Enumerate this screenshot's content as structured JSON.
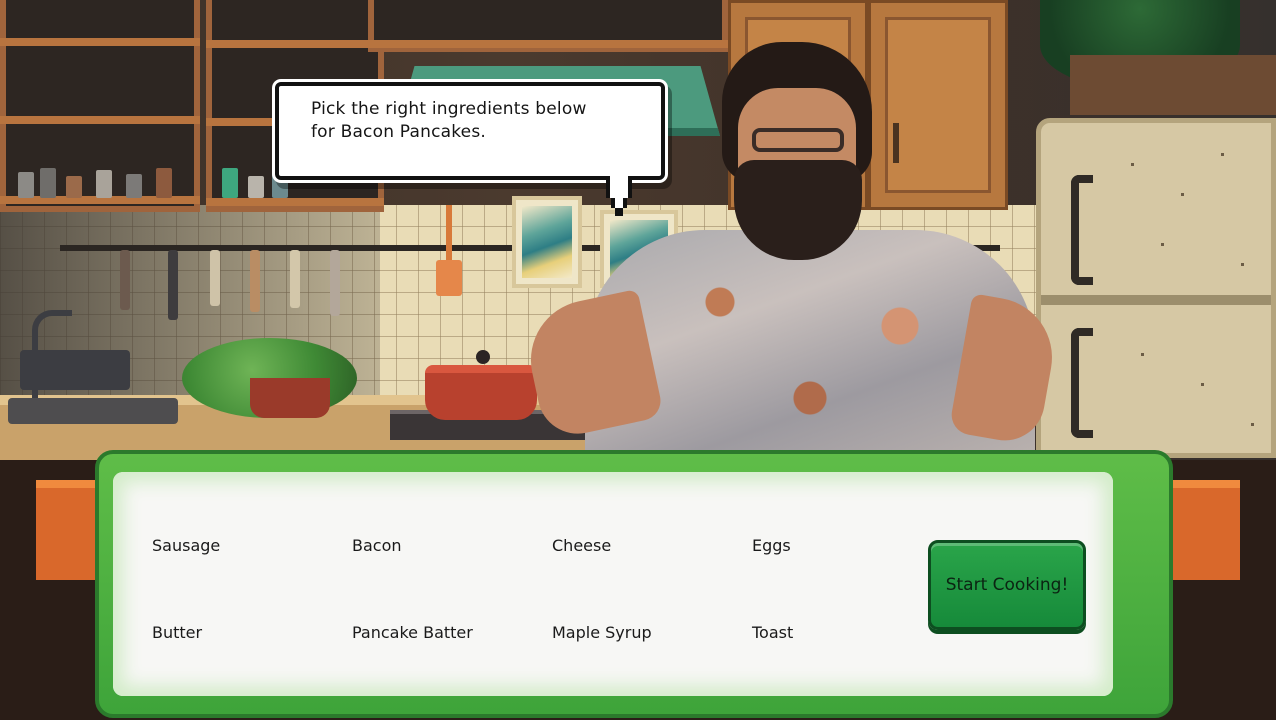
{
  "dialog": {
    "line1": "Pick the right ingredients below",
    "line2": "for Bacon Pancakes."
  },
  "ingredients": [
    {
      "label": "Sausage"
    },
    {
      "label": "Bacon"
    },
    {
      "label": "Cheese"
    },
    {
      "label": "Eggs"
    },
    {
      "label": "Butter"
    },
    {
      "label": "Pancake Batter"
    },
    {
      "label": "Maple Syrup"
    },
    {
      "label": "Toast"
    }
  ],
  "actions": {
    "start_label": "Start Cooking!"
  },
  "colors": {
    "panel_frame": "#3ea43a",
    "panel_fill": "#f7f7f5",
    "start_button": "#1f9a44",
    "speech_bubble": "#ffffff"
  },
  "icons": {
    "background": "kitchen-scene",
    "character": "chef-character"
  }
}
